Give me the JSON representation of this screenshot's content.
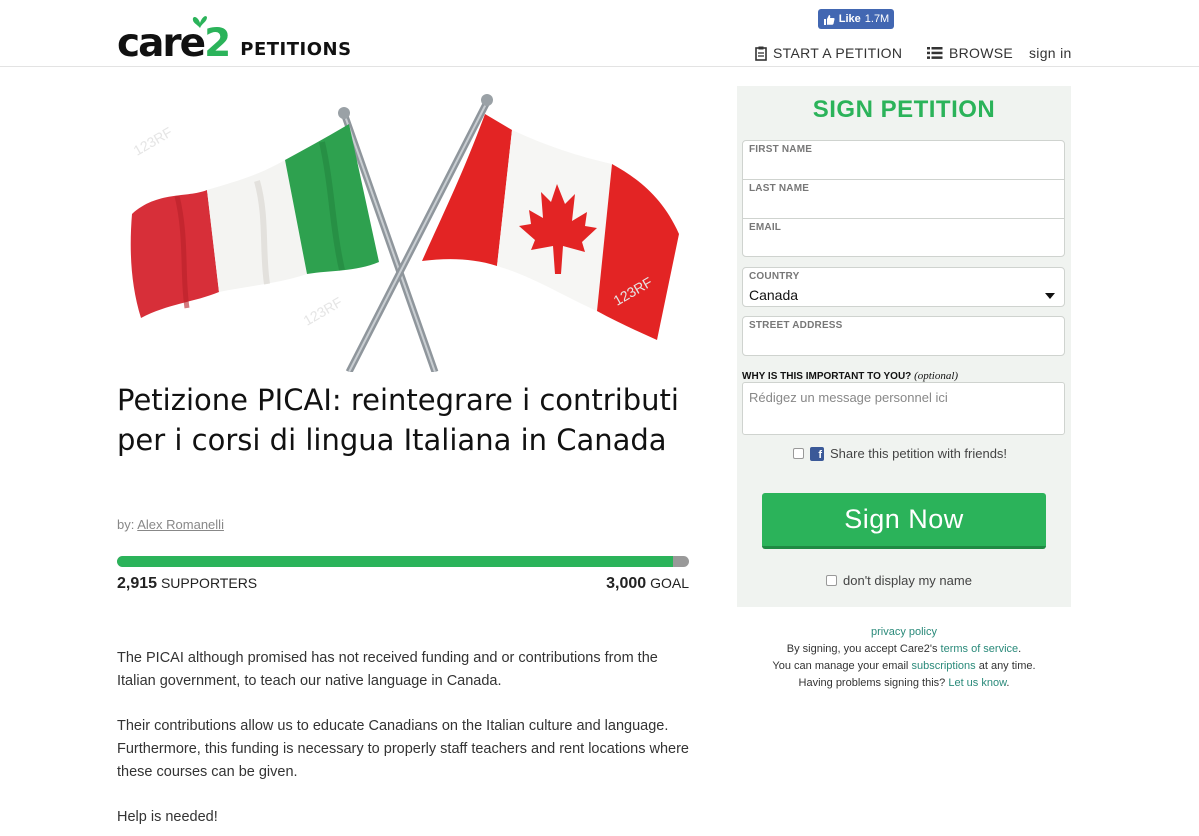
{
  "header": {
    "logo_care": "care",
    "logo_two": "2",
    "logo_petitions": "PETITIONS",
    "fb_like_label": "Like",
    "fb_like_count": "1.7M",
    "nav": {
      "start": "START A PETITION",
      "browse": "BROWSE",
      "signin": "sign in"
    }
  },
  "petition": {
    "title": "Petizione PICAI: reintegrare i contributi per i corsi di lingua Italiana in Canada",
    "by_prefix": "by:",
    "author": "Alex Romanelli",
    "supporters": "2,915",
    "supporters_label": "SUPPORTERS",
    "goal": "3,000",
    "goal_label": "GOAL",
    "progress_fraction": 0.9717,
    "body": [
      "The PICAI although promised has not received funding and or contributions from the Italian government, to teach our native language in Canada.",
      "Their contributions allow us to educate Canadians on the Italian culture and language. Furthermore, this funding is necessary to properly staff teachers and rent locations where these courses can be given.",
      "Help is needed!"
    ],
    "image_watermark": "123RF"
  },
  "sign_panel": {
    "title": "SIGN PETITION",
    "first_name_label": "FIRST NAME",
    "last_name_label": "LAST NAME",
    "email_label": "EMAIL",
    "country_label": "COUNTRY",
    "country_value": "Canada",
    "street_label": "STREET ADDRESS",
    "why_label": "WHY IS THIS IMPORTANT TO YOU?",
    "why_optional": "(optional)",
    "why_placeholder": "Rédigez un message personnel ici",
    "share_label": "Share this petition with friends!",
    "sign_button": "Sign Now",
    "hide_name_label": "don't display my name"
  },
  "footer": {
    "privacy": "privacy policy",
    "terms_prefix": "By signing, you accept Care2's",
    "terms_link": "terms of service",
    "terms_suffix": ".",
    "manage_prefix": "You can manage your email",
    "subscriptions_link": "subscriptions",
    "manage_suffix": "at any time.",
    "problems_prefix": "Having problems signing this?",
    "letusknow_link": "Let us know",
    "problems_suffix": "."
  },
  "colors": {
    "brand_green": "#2bb35a",
    "facebook_blue": "#4267b2",
    "panel_bg": "#f0f3f0",
    "link_teal": "#2a8a7a"
  },
  "icons": [
    "butterfly-icon",
    "thumbs-up-icon",
    "clipboard-icon",
    "list-icon",
    "caret-down-icon",
    "facebook-icon",
    "checkbox-icon"
  ]
}
